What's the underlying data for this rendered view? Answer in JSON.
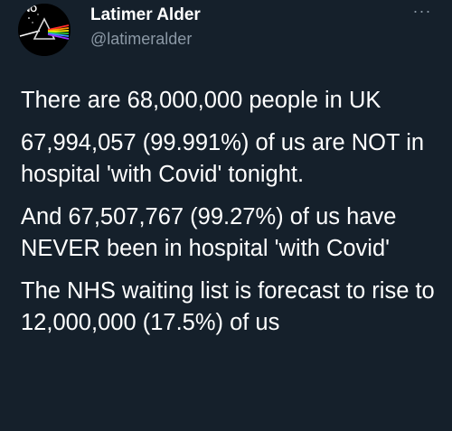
{
  "author": {
    "display_name": "Latimer Alder",
    "handle": "@latimeralder",
    "avatar_text": "NO",
    "avatar_icon": "prism-icon"
  },
  "tweet": {
    "paragraphs": [
      "There are 68,000,000 people in UK",
      "67,994,057 (99.991%) of us are NOT in hospital 'with Covid' tonight.",
      "And 67,507,767 (99.27%) of us have NEVER been in hospital 'with Covid'",
      "The NHS waiting list is forecast to rise to 12,000,000 (17.5%) of us"
    ]
  },
  "more_menu": {
    "label": "···",
    "icon": "more-options-icon"
  },
  "colors": {
    "background": "#15202b",
    "text": "#ffffff",
    "secondary_text": "#8b98a5"
  }
}
